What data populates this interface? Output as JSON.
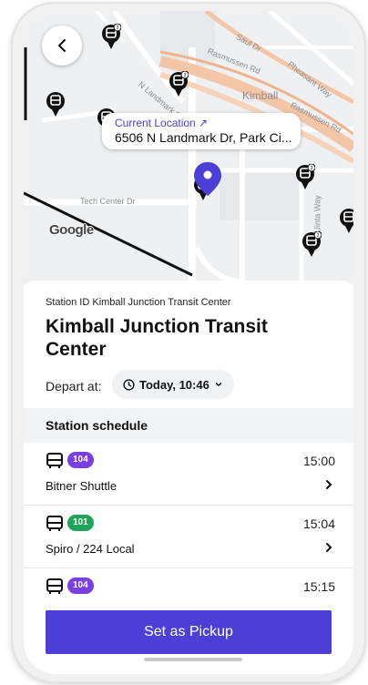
{
  "map": {
    "callout_label": "Current Location ↗",
    "callout_address": "6506 N Landmark Dr, Park Ci...",
    "attribution": "Google",
    "labels": {
      "kimball": "Kimball",
      "rasmussen_rd_1": "Rasmussen Rd",
      "rasmussen_rd_2": "Rasmussen Rd",
      "pheasant_way": "Pheasant Way",
      "tech_center_dr": "Tech Center Dr",
      "uinta_way": "Uinta Way",
      "landmark_dr": "N Landmark Dr",
      "saul_dr": "Saul Dr"
    },
    "bus_marker_counts": [
      "3",
      "3",
      "3",
      "2"
    ]
  },
  "station": {
    "id_line": "Station ID Kimball Junction Transit Center",
    "name": "Kimball Junction Transit Center",
    "depart_label": "Depart at:",
    "depart_value": "Today, 10:46"
  },
  "schedule": {
    "header": "Station schedule",
    "rows": [
      {
        "route_number": "104",
        "route_name": "Bitner Shuttle",
        "time": "15:00",
        "color": "#7b3fe0"
      },
      {
        "route_number": "101",
        "route_name": "Spiro / 224 Local",
        "time": "15:04",
        "color": "#1fa55a"
      },
      {
        "route_number": "104",
        "route_name": "",
        "time": "15:15",
        "color": "#7b3fe0"
      }
    ]
  },
  "actions": {
    "pickup_label": "Set as Pickup"
  },
  "colors": {
    "accent": "#4b3fd8",
    "route_104": "#7b3fe0",
    "route_101": "#1fa55a"
  }
}
